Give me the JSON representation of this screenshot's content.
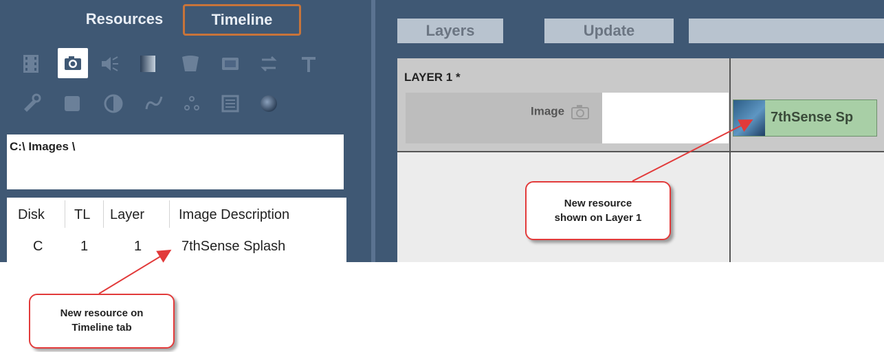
{
  "left_panel": {
    "tabs": [
      {
        "label": "Resources"
      },
      {
        "label": "Timeline"
      }
    ],
    "icons_row1": [
      "film-icon",
      "camera-icon",
      "speaker-icon",
      "gradient-icon",
      "shield-icon",
      "screen-icon",
      "swap-icon",
      "text-icon"
    ],
    "icons_row2": [
      "tools-icon",
      "square-icon",
      "contrast-icon",
      "curve-icon",
      "dots-icon",
      "list-icon",
      "sphere-icon"
    ],
    "path": "C:\\ Images \\",
    "table": {
      "columns": [
        "Disk",
        "TL",
        "Layer",
        "Image Description"
      ],
      "rows": [
        [
          "C",
          "1",
          "1",
          "7thSense Splash"
        ]
      ]
    }
  },
  "right_panel": {
    "toolbar": {
      "layers_label": "Layers",
      "update_label": "Update"
    },
    "layer": {
      "title": "LAYER 1 *",
      "track_label": "Image",
      "clip_label": "7thSense Sp"
    }
  },
  "callouts": {
    "right": {
      "line1": "New resource",
      "line2": "shown on Layer 1"
    },
    "left": {
      "line1": "New resource on",
      "line2": "Timeline tab"
    }
  },
  "colors": {
    "panel_bg": "#3f5874",
    "tab_highlight": "#c8743a",
    "callout_border": "#e23a3a",
    "clip_bg": "#a8cfa6"
  }
}
